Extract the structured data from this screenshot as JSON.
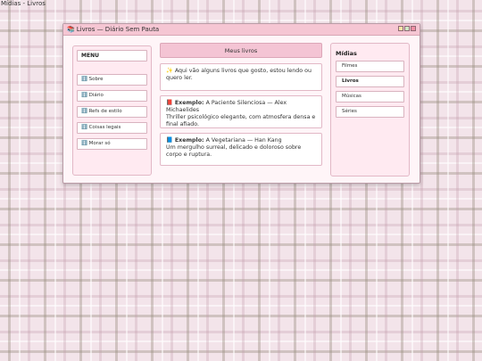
{
  "page": {
    "label": "Mídias - Livros"
  },
  "window": {
    "title_icon": "📚",
    "title": "Livros — Diário Sem Pauta"
  },
  "left_menu": {
    "title": "MENU",
    "items": [
      {
        "label": "ℹ️ Sobre"
      },
      {
        "label": "ℹ️ Diário"
      },
      {
        "label": "ℹ️ Refs de estilo"
      },
      {
        "label": "ℹ️ Coisas legais"
      },
      {
        "label": "ℹ️ Morar só"
      }
    ]
  },
  "main": {
    "header": "Meus livros",
    "intro": "✨ Aqui vão alguns livros que gosto, estou lendo ou quero ler.",
    "books": [
      {
        "icon": "📕",
        "label": "Exemplo:",
        "title_line": "A Paciente Silenciosa — Alex Michaelides",
        "description": "Thriller psicológico elegante, com atmosfera densa e final afiado."
      },
      {
        "icon": "📘",
        "label": "Exemplo:",
        "title_line": "A Vegetariana — Han Kang",
        "description": "Um mergulho surreal, delicado e doloroso sobre corpo e ruptura."
      }
    ]
  },
  "right_menu": {
    "title": "Mídias",
    "items": [
      {
        "label": "Filmes",
        "active": false
      },
      {
        "label": "Livros",
        "active": true
      },
      {
        "label": "Músicas",
        "active": false
      },
      {
        "label": "Séries",
        "active": false
      }
    ]
  },
  "colors": {
    "titlebar": "#f5c6d3",
    "panel": "#ffeaf1",
    "header": "#f4c4d4"
  }
}
